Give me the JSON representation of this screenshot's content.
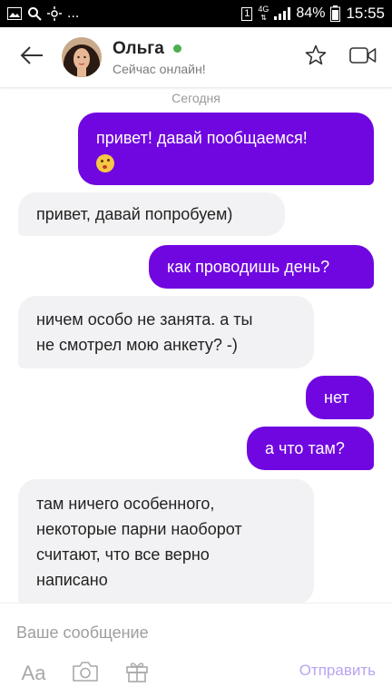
{
  "status_bar": {
    "network_label": "4G",
    "battery": "84%",
    "time": "15:55",
    "sim": "1",
    "left_icons": [
      "image-icon",
      "search-icon",
      "settings-icon",
      "more-icon"
    ],
    "more_label": "..."
  },
  "header": {
    "contact_name": "Ольга",
    "contact_status": "Сейчас онлайн!",
    "online_color": "#4caf50",
    "back_icon": "arrow-left-icon",
    "favorite_icon": "star-icon",
    "video_icon": "video-camera-icon"
  },
  "chat": {
    "date_label": "Сегодня",
    "messages": [
      {
        "direction": "outgoing",
        "lines": [
          "привет! давай пообщаемся!"
        ],
        "emoji": "winking-kiss-emoji"
      },
      {
        "direction": "incoming",
        "lines": [
          "привет, давай попробуем)"
        ]
      },
      {
        "direction": "outgoing",
        "lines": [
          "как проводишь день?"
        ]
      },
      {
        "direction": "incoming",
        "lines": [
          "ничем особо не занята. а ты",
          "не смотрел мою анкету? -)"
        ]
      },
      {
        "direction": "outgoing",
        "lines": [
          "нет"
        ]
      },
      {
        "direction": "outgoing",
        "lines": [
          "а что там?"
        ]
      },
      {
        "direction": "incoming",
        "lines": [
          "там ничего особенного,",
          "некоторые парни наоборот",
          "считают, что все верно",
          "написано"
        ]
      }
    ]
  },
  "composer": {
    "placeholder": "Ваше сообщение",
    "value": "",
    "font_label": "Aa",
    "camera_icon": "camera-icon",
    "gift_icon": "gift-icon",
    "send_label": "Отправить"
  },
  "colors": {
    "outgoing_bubble": "#7007e0",
    "incoming_bubble": "#f2f2f4",
    "send_text": "#b9a4f0"
  }
}
